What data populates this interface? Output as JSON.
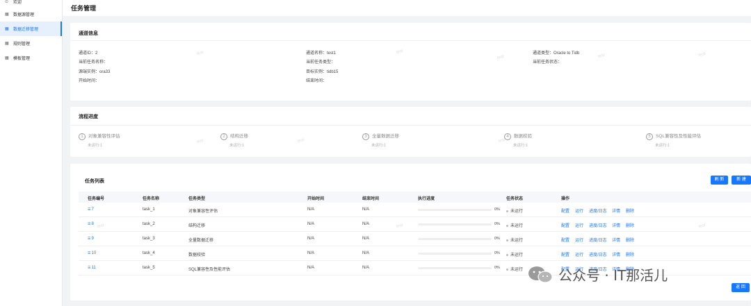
{
  "sidebar": {
    "items": [
      {
        "label": "欢迎",
        "icon": "home-icon"
      },
      {
        "label": "数据源管理",
        "icon": "grid-icon"
      },
      {
        "label": "数据迁移管理",
        "icon": "grid-icon"
      },
      {
        "label": "规则管理",
        "icon": "grid-icon"
      },
      {
        "label": "模板管理",
        "icon": "grid-icon"
      }
    ],
    "active_index": 2
  },
  "header": {
    "title": "任务管理"
  },
  "channel_info": {
    "title": "通道信息",
    "fields": {
      "channel_id": "通道ID：2",
      "channel_name": "通道名称：test1",
      "channel_type": "通道类型：Oracle to Tidb",
      "current_task_name": "当前任务名称：",
      "current_task_type": "当前任务类型：",
      "current_task_status": "当前任务状态：",
      "source_instance": "源端实例：ora33",
      "target_instance": "目标实例：tidb15",
      "start_time": "开始时间：",
      "end_time": "结束时间："
    }
  },
  "flow": {
    "title": "流程进度",
    "steps": [
      {
        "num": "1",
        "name": "对象兼容性评估",
        "sub": "未运行:1"
      },
      {
        "num": "2",
        "name": "结构迁移",
        "sub": "未运行:1"
      },
      {
        "num": "3",
        "name": "全量数据迁移",
        "sub": "未运行:1"
      },
      {
        "num": "4",
        "name": "数据校验",
        "sub": "未运行:1"
      },
      {
        "num": "5",
        "name": "SQL兼容性及性能评估",
        "sub": "未运行:1"
      }
    ]
  },
  "task_list": {
    "title": "任务列表",
    "refresh_label": "刷 新",
    "new_label": "新 建",
    "back_label": "返 回",
    "columns": [
      "任务编号",
      "任务名称",
      "任务类型",
      "开始时间",
      "结束时间",
      "执行进度",
      "任务状态",
      "操作"
    ],
    "rows": [
      {
        "id": "7",
        "name": "task_1",
        "type": "对象兼容性评估",
        "start": "N/A",
        "end": "N/A",
        "progress": 0,
        "progress_label": "0%",
        "status": "未运行"
      },
      {
        "id": "8",
        "name": "task_2",
        "type": "结构迁移",
        "start": "N/A",
        "end": "N/A",
        "progress": 0,
        "progress_label": "0%",
        "status": "未运行"
      },
      {
        "id": "9",
        "name": "task_3",
        "type": "全量数据迁移",
        "start": "N/A",
        "end": "N/A",
        "progress": 0,
        "progress_label": "0%",
        "status": "未运行"
      },
      {
        "id": "10",
        "name": "task_4",
        "type": "数据校验",
        "start": "N/A",
        "end": "N/A",
        "progress": 0,
        "progress_label": "0%",
        "status": "未运行"
      },
      {
        "id": "11",
        "name": "task_5",
        "type": "SQL兼容性及性能评估",
        "start": "N/A",
        "end": "N/A",
        "progress": 0,
        "progress_label": "0%",
        "status": "未运行"
      }
    ],
    "actions": [
      "配置",
      "运行",
      "进度/日志",
      "详情",
      "删除"
    ]
  },
  "watermark_text": "test",
  "wechat_caption": "公众号 · IT那活儿",
  "colors": {
    "accent": "#1677ff",
    "background": "#f2f3f5"
  }
}
